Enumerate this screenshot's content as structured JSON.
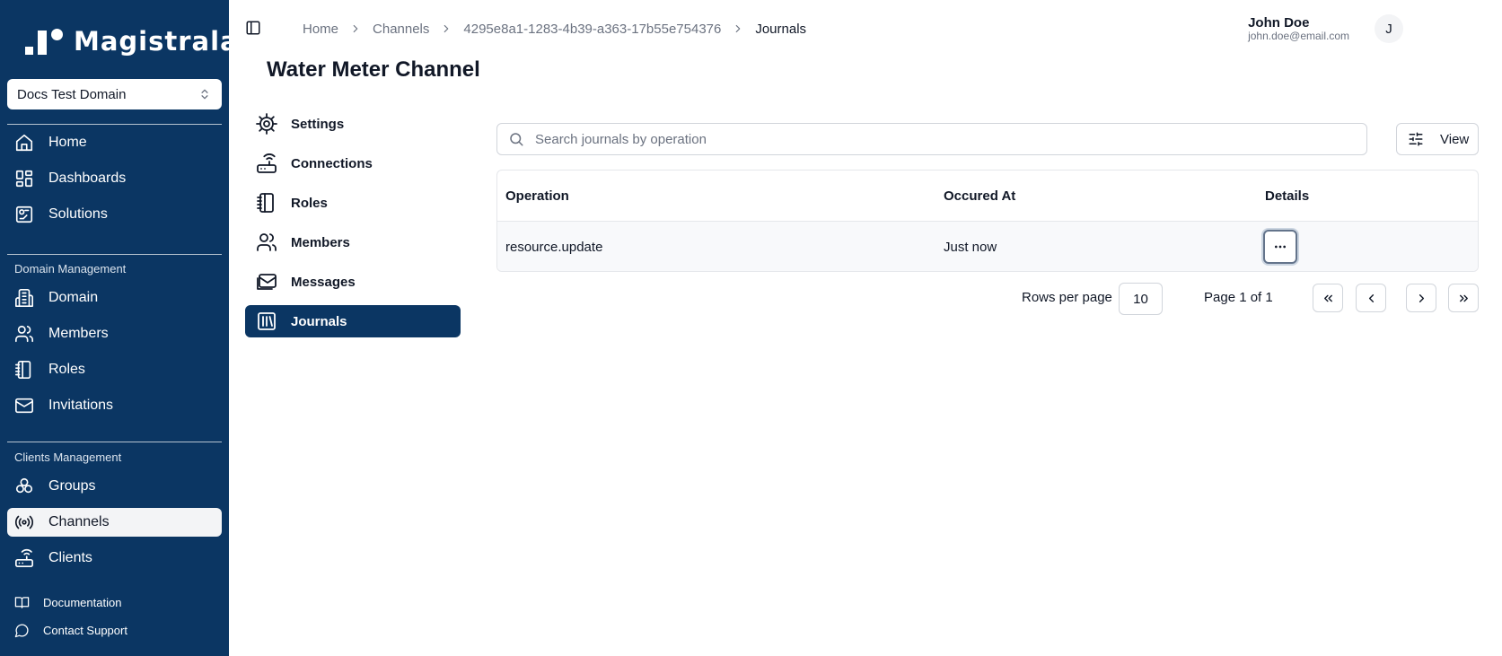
{
  "brand": {
    "name": "Magistrala"
  },
  "domain_selector": {
    "value": "Docs Test Domain"
  },
  "sidebar": {
    "main": [
      {
        "label": "Home",
        "icon": "home-icon"
      },
      {
        "label": "Dashboards",
        "icon": "dashboard-icon"
      },
      {
        "label": "Solutions",
        "icon": "solutions-icon"
      }
    ],
    "domain_section": "Domain Management",
    "domain_items": [
      {
        "label": "Domain",
        "icon": "building-icon"
      },
      {
        "label": "Members",
        "icon": "users-icon"
      },
      {
        "label": "Roles",
        "icon": "notebook-icon"
      },
      {
        "label": "Invitations",
        "icon": "mail-icon"
      }
    ],
    "clients_section": "Clients Management",
    "clients_items": [
      {
        "label": "Groups",
        "icon": "groups-icon"
      },
      {
        "label": "Channels",
        "icon": "radio-icon",
        "active": true
      },
      {
        "label": "Clients",
        "icon": "router-icon"
      }
    ],
    "footer": [
      {
        "label": "Documentation",
        "icon": "book-icon"
      },
      {
        "label": "Contact Support",
        "icon": "chat-icon"
      }
    ]
  },
  "breadcrumb": [
    "Home",
    "Channels",
    "4295e8a1-1283-4b39-a363-17b55e754376",
    "Journals"
  ],
  "user": {
    "name": "John Doe",
    "email": "john.doe@email.com",
    "initial": "J"
  },
  "page": {
    "title": "Water Meter Channel"
  },
  "subnav": [
    {
      "label": "Settings",
      "icon": "gear-icon"
    },
    {
      "label": "Connections",
      "icon": "router-icon"
    },
    {
      "label": "Roles",
      "icon": "notebook-icon"
    },
    {
      "label": "Members",
      "icon": "users-icon"
    },
    {
      "label": "Messages",
      "icon": "mail-icon"
    },
    {
      "label": "Journals",
      "icon": "library-icon",
      "active": true
    }
  ],
  "search": {
    "placeholder": "Search journals by operation",
    "value": ""
  },
  "view_button": {
    "label": "View"
  },
  "table": {
    "columns": [
      "Operation",
      "Occured At",
      "Details"
    ],
    "rows": [
      {
        "operation": "resource.update",
        "occurred_at": "Just now"
      }
    ]
  },
  "pagination": {
    "rows_label": "Rows per page",
    "rows_per_page": "10",
    "page_label": "Page 1 of 1"
  },
  "colors": {
    "sidebar_bg": "#0b3663",
    "active_bg": "#0b3663"
  }
}
